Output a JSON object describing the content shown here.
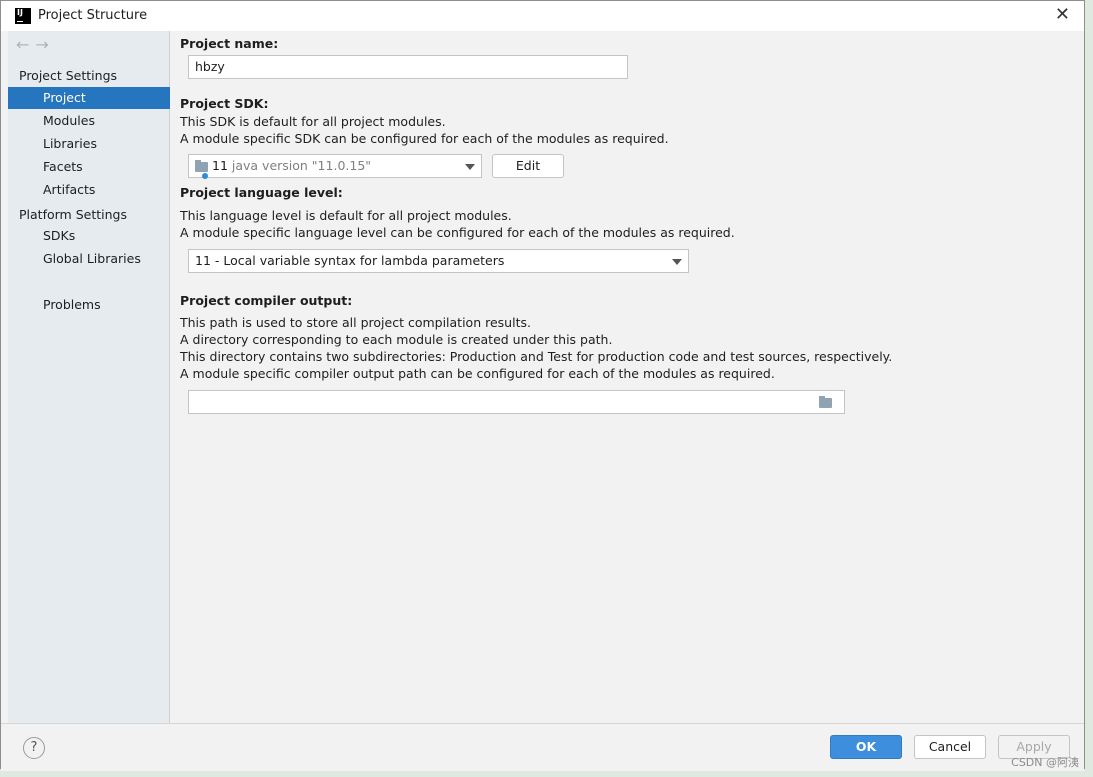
{
  "window": {
    "title": "Project Structure",
    "icon": "intellij-idea-icon"
  },
  "sidebar": {
    "project_settings_label": "Project Settings",
    "project_items": [
      "Project",
      "Modules",
      "Libraries",
      "Facets",
      "Artifacts"
    ],
    "platform_settings_label": "Platform Settings",
    "platform_items": [
      "SDKs",
      "Global Libraries"
    ],
    "other_items": [
      "Problems"
    ],
    "selected": "Project"
  },
  "main": {
    "project_name": {
      "label": "Project name:",
      "value": "hbzy"
    },
    "sdk": {
      "label": "Project SDK:",
      "desc1": "This SDK is default for all project modules.",
      "desc2": "A module specific SDK can be configured for each of the modules as required.",
      "version_number": "11",
      "version_text": "java version \"11.0.15\"",
      "edit_label": "Edit"
    },
    "language_level": {
      "label": "Project language level:",
      "desc1": "This language level is default for all project modules.",
      "desc2": "A module specific language level can be configured for each of the modules as required.",
      "value": "11 - Local variable syntax for lambda parameters"
    },
    "compiler_output": {
      "label": "Project compiler output:",
      "desc1": "This path is used to store all project compilation results.",
      "desc2": "A directory corresponding to each module is created under this path.",
      "desc3": "This directory contains two subdirectories: Production and Test for production code and test sources, respectively.",
      "desc4": "A module specific compiler output path can be configured for each of the modules as required.",
      "value": ""
    }
  },
  "footer": {
    "help_label": "?",
    "ok_label": "OK",
    "cancel_label": "Cancel",
    "apply_label": "Apply"
  },
  "watermark": "CSDN @阿洟",
  "colors": {
    "selection": "#2675bf",
    "ok_button": "#3d8fdd",
    "sidebar_bg": "#e6ebf0"
  }
}
